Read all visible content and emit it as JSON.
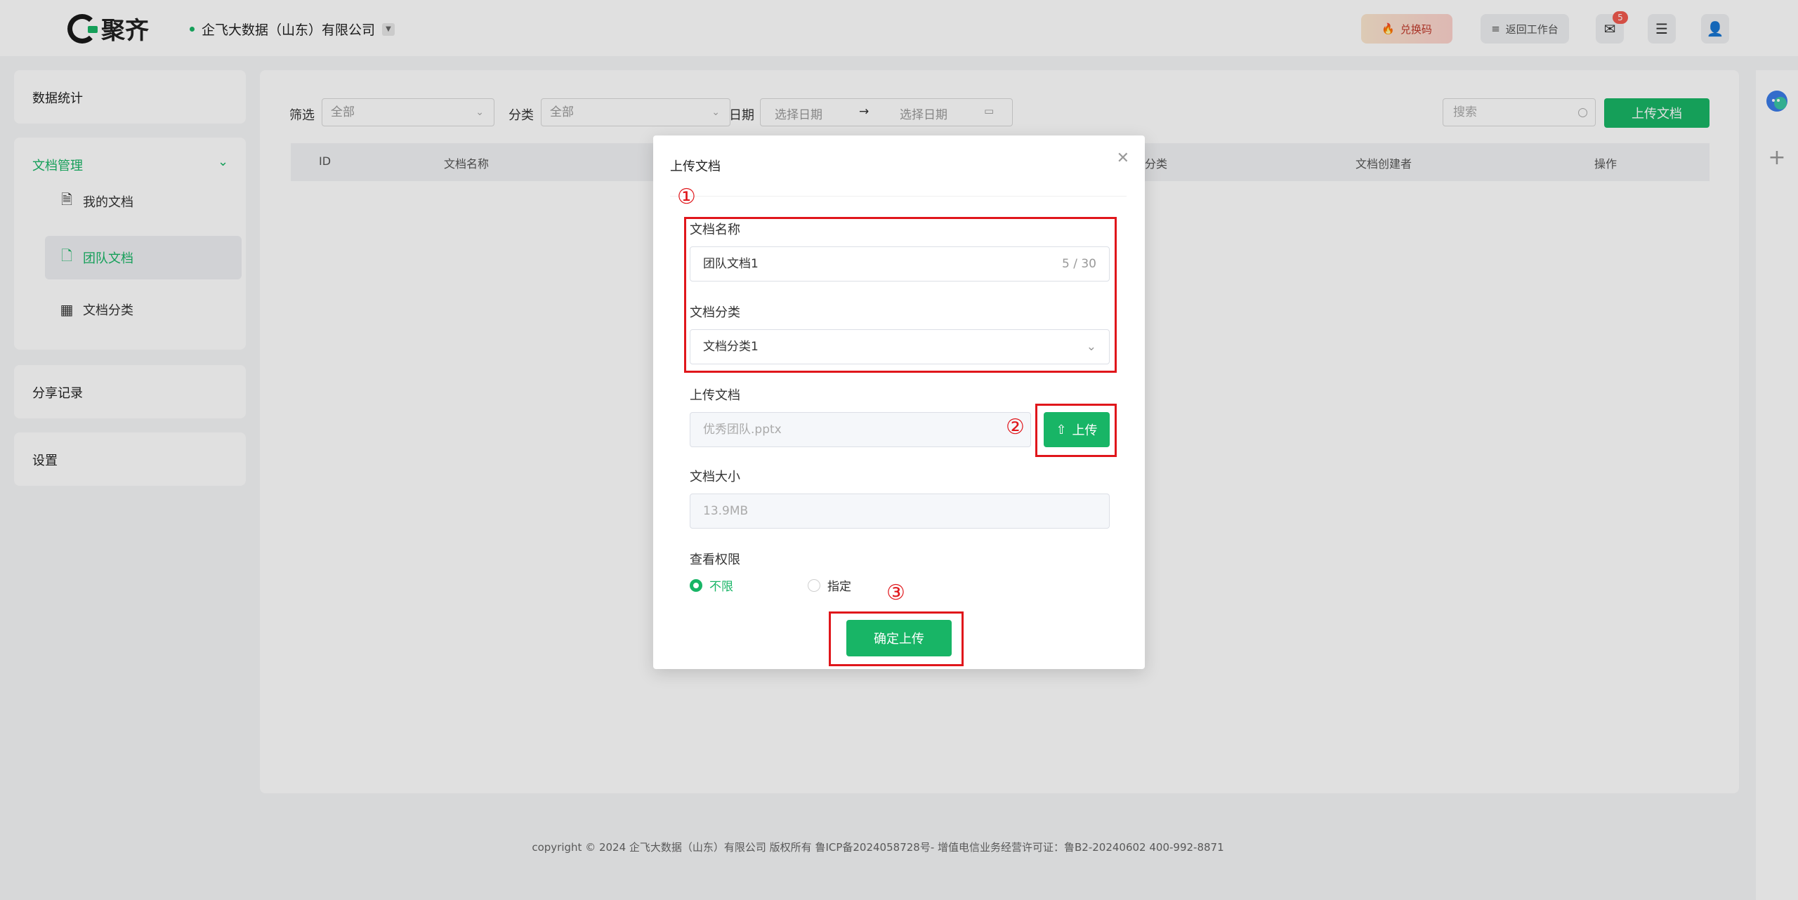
{
  "header": {
    "logo_text": "聚齐",
    "company": "企飞大数据（山东）有限公司",
    "redeem_label": "兑换码",
    "back_label": "返回工作台",
    "mail_badge": "5"
  },
  "sidebar": {
    "stats": "数据统计",
    "doc_manage": "文档管理",
    "items": [
      {
        "label": "我的文档",
        "icon": "my-docs-icon"
      },
      {
        "label": "团队文档",
        "icon": "team-docs-icon"
      },
      {
        "label": "文档分类",
        "icon": "grid-icon"
      }
    ],
    "share": "分享记录",
    "settings": "设置"
  },
  "filters": {
    "filter_label": "筛选",
    "filter_value": "全部",
    "category_label": "分类",
    "category_value": "全部",
    "date_label": "日期",
    "start_placeholder": "选择日期",
    "end_placeholder": "选择日期",
    "search_placeholder": "搜索",
    "upload_label": "上传文档"
  },
  "table": {
    "columns": [
      "ID",
      "文档名称",
      "分类",
      "文档创建者",
      "操作"
    ]
  },
  "modal": {
    "title": "上传文档",
    "name_label": "文档名称",
    "name_value": "团队文档1",
    "name_counter": "5 / 30",
    "category_label": "文档分类",
    "category_value": "文档分类1",
    "file_label": "上传文档",
    "file_value": "优秀团队.pptx",
    "upload_btn": "上传",
    "size_label": "文档大小",
    "size_value": "13.9MB",
    "perm_label": "查看权限",
    "perm_unlimited": "不限",
    "perm_specified": "指定",
    "confirm": "确定上传"
  },
  "annotations": [
    "①",
    "②",
    "③"
  ],
  "footer": "copyright © 2024 企飞大数据（山东）有限公司 版权所有  鲁ICP备2024058728号-  增值电信业务经营许可证：鲁B2-20240602  400-992-8871",
  "colors": {
    "accent": "#18b566",
    "annotation": "#e0161b"
  }
}
